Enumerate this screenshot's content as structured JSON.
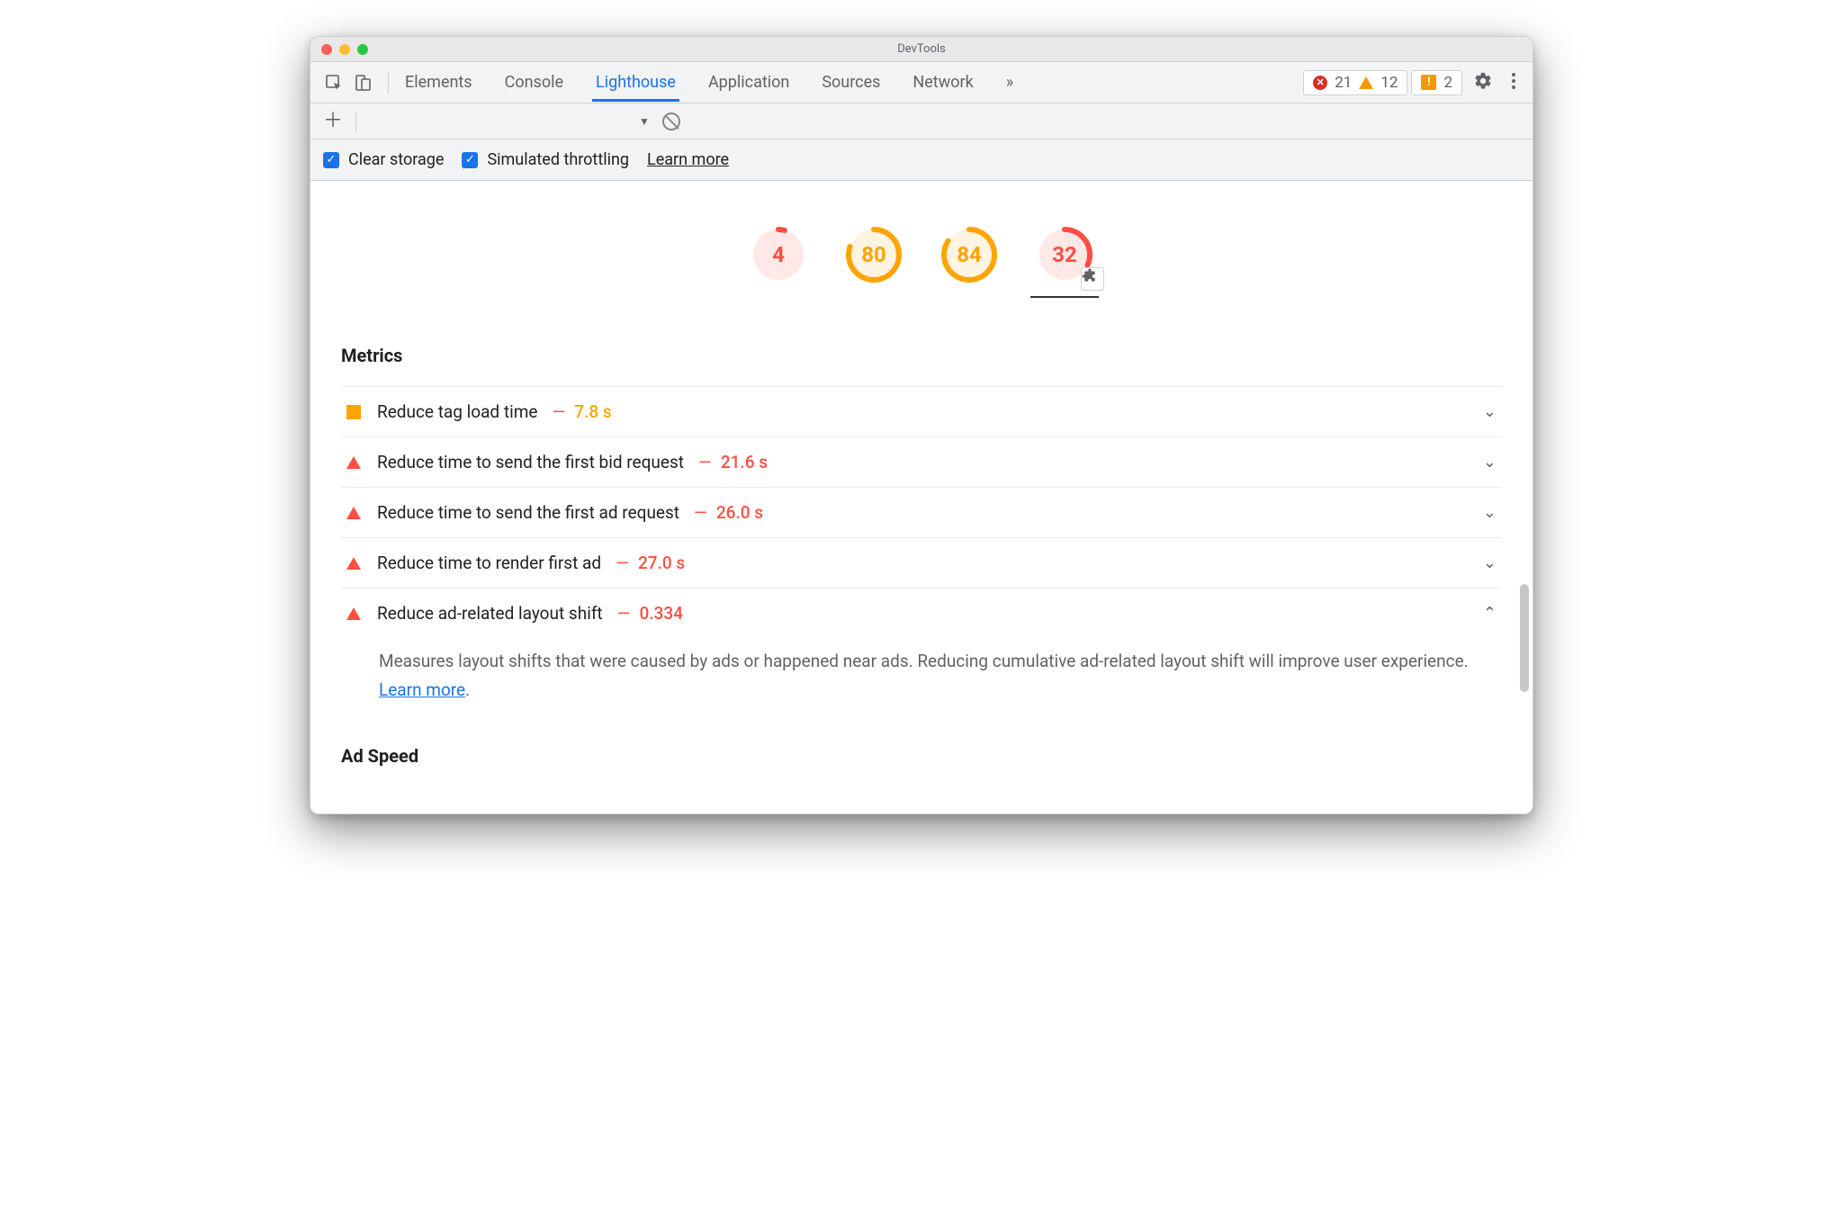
{
  "window": {
    "title": "DevTools"
  },
  "tabs": {
    "t0": "Elements",
    "t1": "Console",
    "t2": "Lighthouse",
    "t3": "Application",
    "t4": "Sources",
    "t5": "Network"
  },
  "counts": {
    "errors": "21",
    "warnings": "12",
    "issues": "2"
  },
  "options": {
    "clear": "Clear storage",
    "throttle": "Simulated throttling",
    "learn": "Learn more"
  },
  "scores": {
    "s0": "4",
    "s1": "80",
    "s2": "84",
    "s3": "32"
  },
  "sections": {
    "metrics": "Metrics",
    "adspeed": "Ad Speed"
  },
  "metrics": {
    "m0": {
      "label": "Reduce tag load time",
      "val": "7.8 s"
    },
    "m1": {
      "label": "Reduce time to send the first bid request",
      "val": "21.6 s"
    },
    "m2": {
      "label": "Reduce time to send the first ad request",
      "val": "26.0 s"
    },
    "m3": {
      "label": "Reduce time to render first ad",
      "val": "27.0 s"
    },
    "m4": {
      "label": "Reduce ad-related layout shift",
      "val": "0.334"
    }
  },
  "desc": {
    "text": "Measures layout shifts that were caused by ads or happened near ads. Reducing cumulative ad-related layout shift will improve user experience. ",
    "link": "Learn more",
    "suffix": "."
  }
}
